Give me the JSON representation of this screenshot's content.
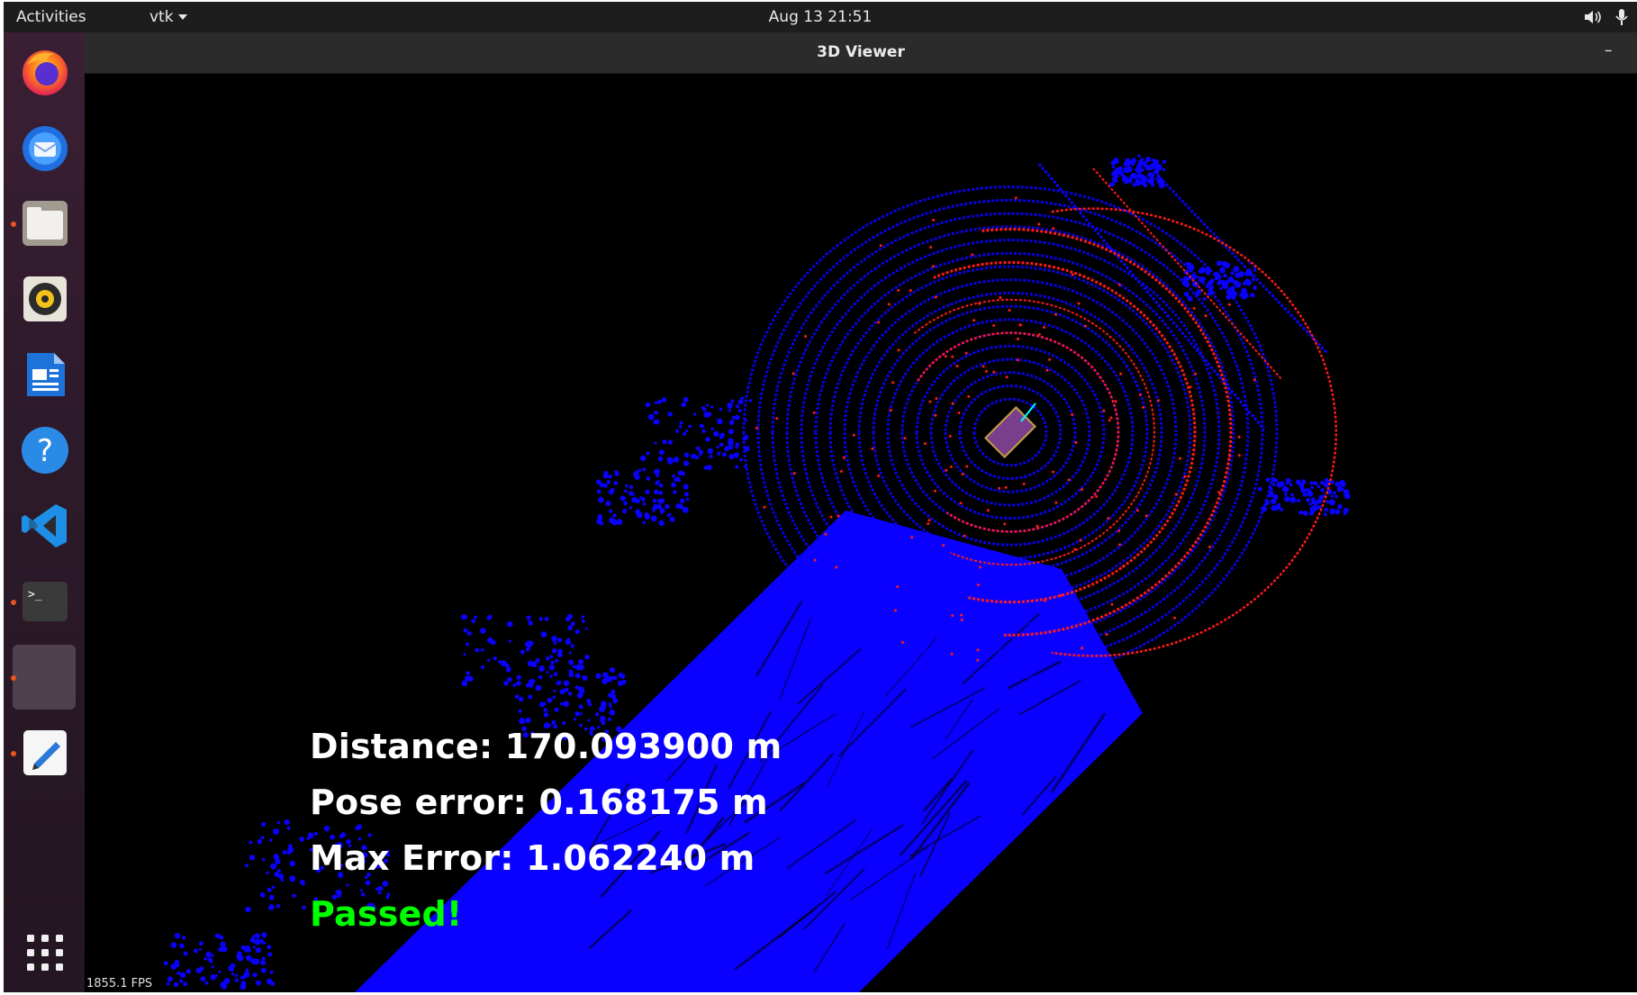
{
  "topbar": {
    "activities": "Activities",
    "app_menu": "vtk",
    "clock": "Aug 13  21:51",
    "tray_icons": [
      "volume-icon",
      "microphone-icon"
    ]
  },
  "dock": {
    "items": [
      {
        "name": "firefox",
        "icon": "firefox-icon",
        "running": false
      },
      {
        "name": "thunderbird",
        "icon": "thunderbird-icon",
        "running": false
      },
      {
        "name": "files",
        "icon": "files-icon",
        "running": true
      },
      {
        "name": "rhythmbox",
        "icon": "rhythmbox-icon",
        "running": false
      },
      {
        "name": "libreoffice-writer",
        "icon": "writer-icon",
        "running": false
      },
      {
        "name": "help",
        "icon": "help-icon",
        "running": false
      },
      {
        "name": "vscode",
        "icon": "vscode-icon",
        "running": false
      },
      {
        "name": "terminal",
        "icon": "terminal-icon",
        "running": true
      },
      {
        "name": "vtk-window",
        "icon": "blank-app-icon",
        "running": true,
        "active": true
      },
      {
        "name": "text-editor",
        "icon": "text-editor-icon",
        "running": true
      }
    ],
    "show_apps_icon": "app-grid-icon"
  },
  "window": {
    "title": "3D Viewer",
    "minimize_label": "–"
  },
  "viewer": {
    "distance": "Distance: 170.093900 m",
    "pose_error": "Pose error: 0.168175 m",
    "max_error": "Max Error: 1.062240 m",
    "status": "Passed!",
    "fps": "1855.1 FPS",
    "colors": {
      "point_cloud": "#0a00ff",
      "scan_points": "#ff1a1a",
      "status_pass": "#00ff00",
      "vehicle_box": "#7a3f8c",
      "heading": "#00ffff"
    }
  }
}
